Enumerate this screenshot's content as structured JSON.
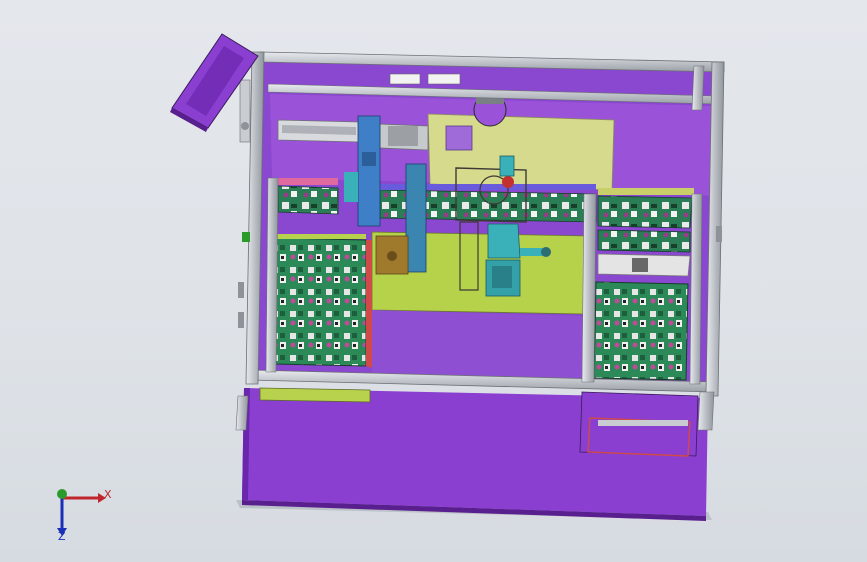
{
  "viewport": {
    "background_top": "#e4e7ec",
    "background_bottom": "#d6dbe1"
  },
  "model_colors": {
    "base_plate": "#8a3fd0",
    "base_plate_dark": "#6a26ad",
    "frame_profile": "#c9ccd1",
    "frame_profile_dark": "#8e9399",
    "top_cover": "#a25ad6",
    "work_table": "#b8d24e",
    "work_table_light": "#d4d98a",
    "pcb_tray": "#2c8a58",
    "pcb_tray_dark": "#1d5e3c",
    "gantry_blue": "#3f7fc8",
    "cyan_block": "#3ab0b8",
    "brown_block": "#a07a2c",
    "red_rail": "#d04a4a",
    "pink_rail": "#e06aa0"
  },
  "triad": {
    "x_label": "X",
    "z_label": "Z",
    "x_color": "#c0262c",
    "y_color": "#2a9a2a",
    "z_color": "#1a2fb8"
  }
}
